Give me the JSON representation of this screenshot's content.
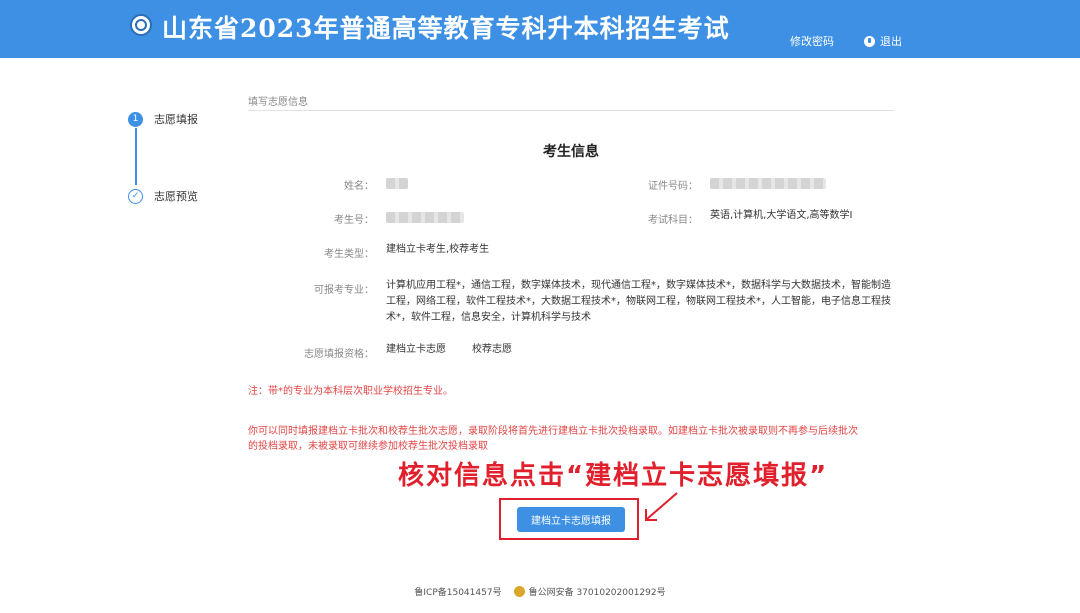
{
  "header": {
    "title": "山东省2023年普通高等教育专科升本科招生考试",
    "change_password": "修改密码",
    "logout": "退出"
  },
  "steps": [
    {
      "index": "1",
      "label": "志愿填报",
      "state": "active"
    },
    {
      "index": "✓",
      "label": "志愿预览",
      "state": "done"
    }
  ],
  "section": {
    "title": "填写志愿信息",
    "card_title": "考生信息"
  },
  "fields": {
    "name_label": "姓名：",
    "id_label": "证件号码：",
    "exam_no_label": "考生号：",
    "subjects_label": "考试科目：",
    "subjects_value": "英语,计算机,大学语文,高等数学I",
    "type_label": "考生类型：",
    "type_value": "建档立卡考生,校荐考生",
    "majors_label": "可报考专业：",
    "majors_value": "计算机应用工程*，通信工程，数字媒体技术，现代通信工程*，数字媒体技术*，数据科学与大数据技术，智能制造工程，网络工程，软件工程技术*，大数据工程技术*，物联网工程，物联网工程技术*，人工智能，电子信息工程技术*，软件工程，信息安全，计算机科学与技术",
    "qual_label": "志愿填报资格：",
    "qual_1": "建档立卡志愿",
    "qual_2": "校荐志愿"
  },
  "notes": {
    "star_note": "注：带*的专业为本科层次职业学校招生专业。",
    "order_line1": "你可以同时填报建档立卡批次和校荐生批次志愿，录取阶段将首先进行建档立卡批次投档录取。如建档立卡批次被录取则不再参与后续批次",
    "order_line2": "的投档录取，未被录取可继续参加校荐生批次投档录取"
  },
  "callout": "核对信息点击“建档立卡志愿填报”",
  "submit_button": "建档立卡志愿填报",
  "footer": {
    "icp": "鲁ICP备15041457号",
    "police": "鲁公网安备 37010202001292号"
  },
  "colors": {
    "primary": "#3d90e3",
    "alert_red": "#e24545",
    "callout_red": "#e0202c"
  }
}
